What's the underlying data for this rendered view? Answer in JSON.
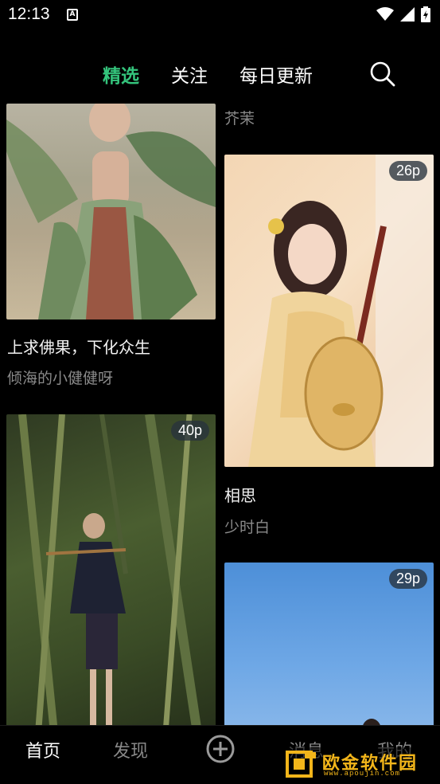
{
  "status_bar": {
    "time": "12:13",
    "notification_icon": "a-box-icon",
    "icons": [
      "wifi-icon",
      "signal-icon",
      "battery-charging-icon"
    ]
  },
  "top_nav": {
    "tabs": [
      {
        "label": "精选",
        "active": true
      },
      {
        "label": "关注",
        "active": false
      },
      {
        "label": "每日更新",
        "active": false
      }
    ],
    "search_icon": "search-icon",
    "accent_color": "#34c47c"
  },
  "feed": {
    "left_column": [
      {
        "title": "上求佛果，下化众生",
        "author": "倾海的小健健呀",
        "badge": ""
      },
      {
        "title": "",
        "author": "",
        "badge": "40p"
      }
    ],
    "right_column": [
      {
        "title": "",
        "author": "芥茉",
        "badge": ""
      },
      {
        "title": "相思",
        "author": "少时白",
        "badge": "26p"
      },
      {
        "title": "",
        "author": "",
        "badge": "29p"
      }
    ]
  },
  "bottom_nav": {
    "items": [
      {
        "label": "首页",
        "active": true
      },
      {
        "label": "发现",
        "active": false
      },
      {
        "label": "消息",
        "active": false
      },
      {
        "label": "我的",
        "active": false
      }
    ],
    "add_icon": "plus-circle-icon"
  },
  "watermark": {
    "text": "欧金软件园",
    "url": "www.apoujin.com"
  }
}
